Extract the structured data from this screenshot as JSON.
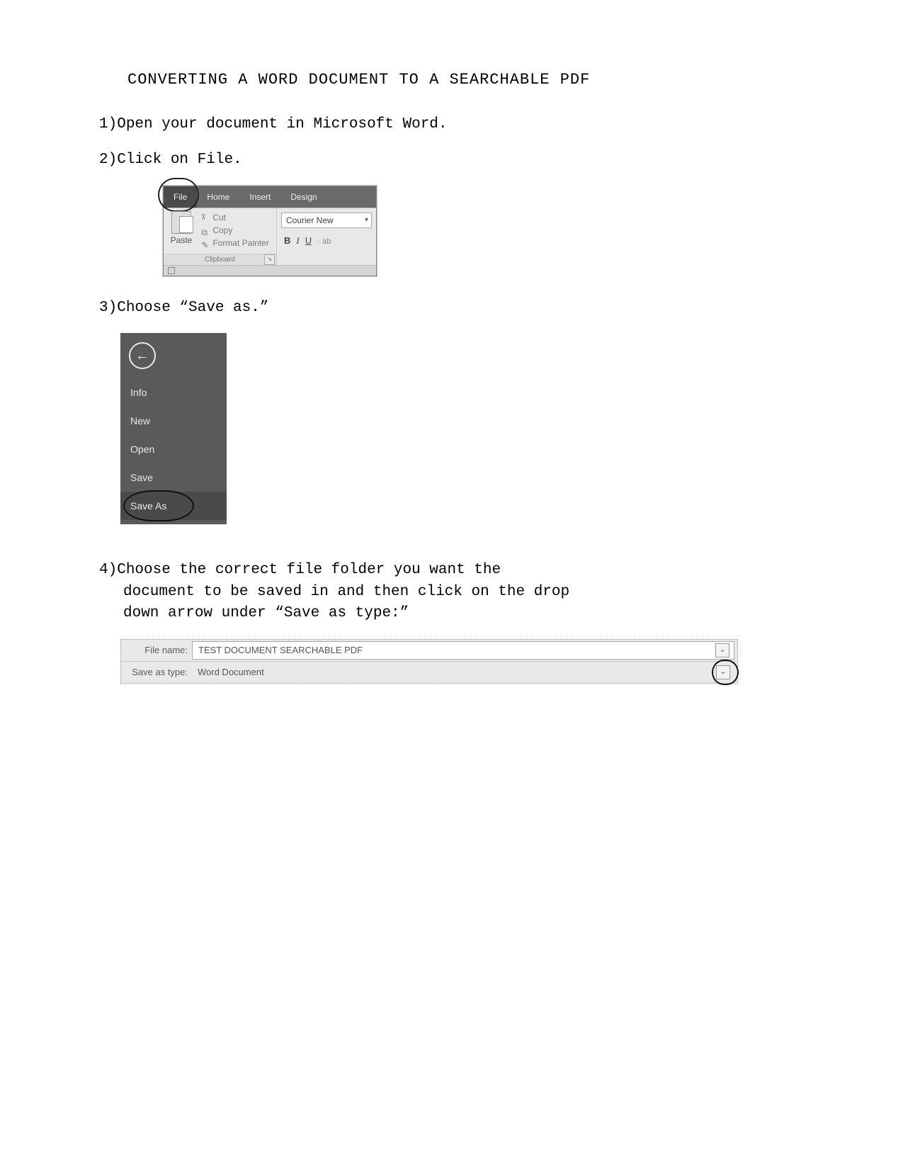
{
  "title": "CONVERTING A WORD DOCUMENT TO A SEARCHABLE PDF",
  "steps": {
    "s1": "Open your document in Microsoft Word.",
    "s2": "Click on File.",
    "s3": "Choose “Save as.”",
    "s4a": "Choose the correct file folder you want the",
    "s4b": "document to be saved in and then click on the drop",
    "s4c": "down arrow under “Save as type:”"
  },
  "ribbon": {
    "tabs": {
      "file": "File",
      "home": "Home",
      "insert": "Insert",
      "design": "Design"
    },
    "clipboard": {
      "paste": "Paste",
      "cut": "Cut",
      "copy": "Copy",
      "format_painter": "Format Painter",
      "group": "Clipboard"
    },
    "font": {
      "name": "Courier New",
      "b": "B",
      "i": "I",
      "u": "U",
      "more": "· ab"
    }
  },
  "backstage": {
    "info": "Info",
    "new": "New",
    "open": "Open",
    "save": "Save",
    "saveas": "Save As"
  },
  "savebar": {
    "filename_label": "File name:",
    "filename_value": "TEST DOCUMENT SEARCHABLE PDF",
    "type_label": "Save as type:",
    "type_value": "Word Document"
  }
}
